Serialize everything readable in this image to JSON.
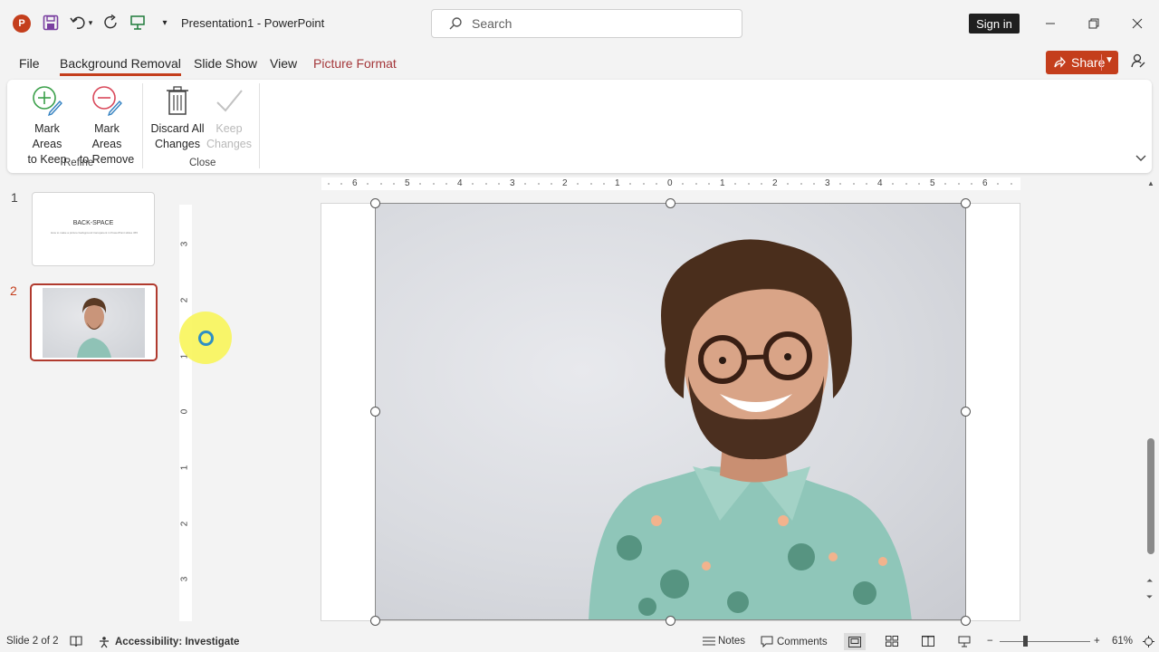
{
  "app": {
    "title": "Presentation1  -  PowerPoint",
    "logo_letter": "P"
  },
  "search": {
    "placeholder": "Search"
  },
  "account": {
    "signin_label": "Sign in"
  },
  "tabs": [
    {
      "label": "File"
    },
    {
      "label": "Background Removal",
      "active": true
    },
    {
      "label": "Slide Show"
    },
    {
      "label": "View"
    },
    {
      "label": "Picture Format"
    }
  ],
  "share": {
    "label": "Share"
  },
  "ribbon": {
    "buttons": [
      {
        "line1": "Mark Areas",
        "line2": "to Keep",
        "icon": "pencil-plus-icon"
      },
      {
        "line1": "Mark Areas",
        "line2": "to Remove",
        "icon": "pencil-minus-icon"
      },
      {
        "line1": "Discard All",
        "line2": "Changes",
        "icon": "trash-icon"
      },
      {
        "line1": "Keep",
        "line2": "Changes",
        "icon": "checkmark-icon",
        "disabled": true
      }
    ],
    "groups": [
      {
        "label": "Refine"
      },
      {
        "label": "Close"
      }
    ]
  },
  "thumbnails": [
    {
      "number": "1",
      "title": "BACK-SPACE",
      "subtitle": "How to make a picture background transparent in PowerPoint slides 365"
    },
    {
      "number": "2",
      "selected": true
    }
  ],
  "rulers": {
    "horizontal": [
      "6",
      "5",
      "4",
      "3",
      "2",
      "1",
      "0",
      "1",
      "2",
      "3",
      "4",
      "5",
      "6"
    ],
    "vertical": [
      "3",
      "2",
      "1",
      "0",
      "1",
      "2",
      "3"
    ]
  },
  "status": {
    "slide_info": "Slide 2 of 2",
    "accessibility": "Accessibility: Investigate",
    "notes": "Notes",
    "comments": "Comments",
    "zoom": "61%"
  },
  "colors": {
    "accent": "#c43e1c",
    "picture_format": "#a4373a"
  }
}
